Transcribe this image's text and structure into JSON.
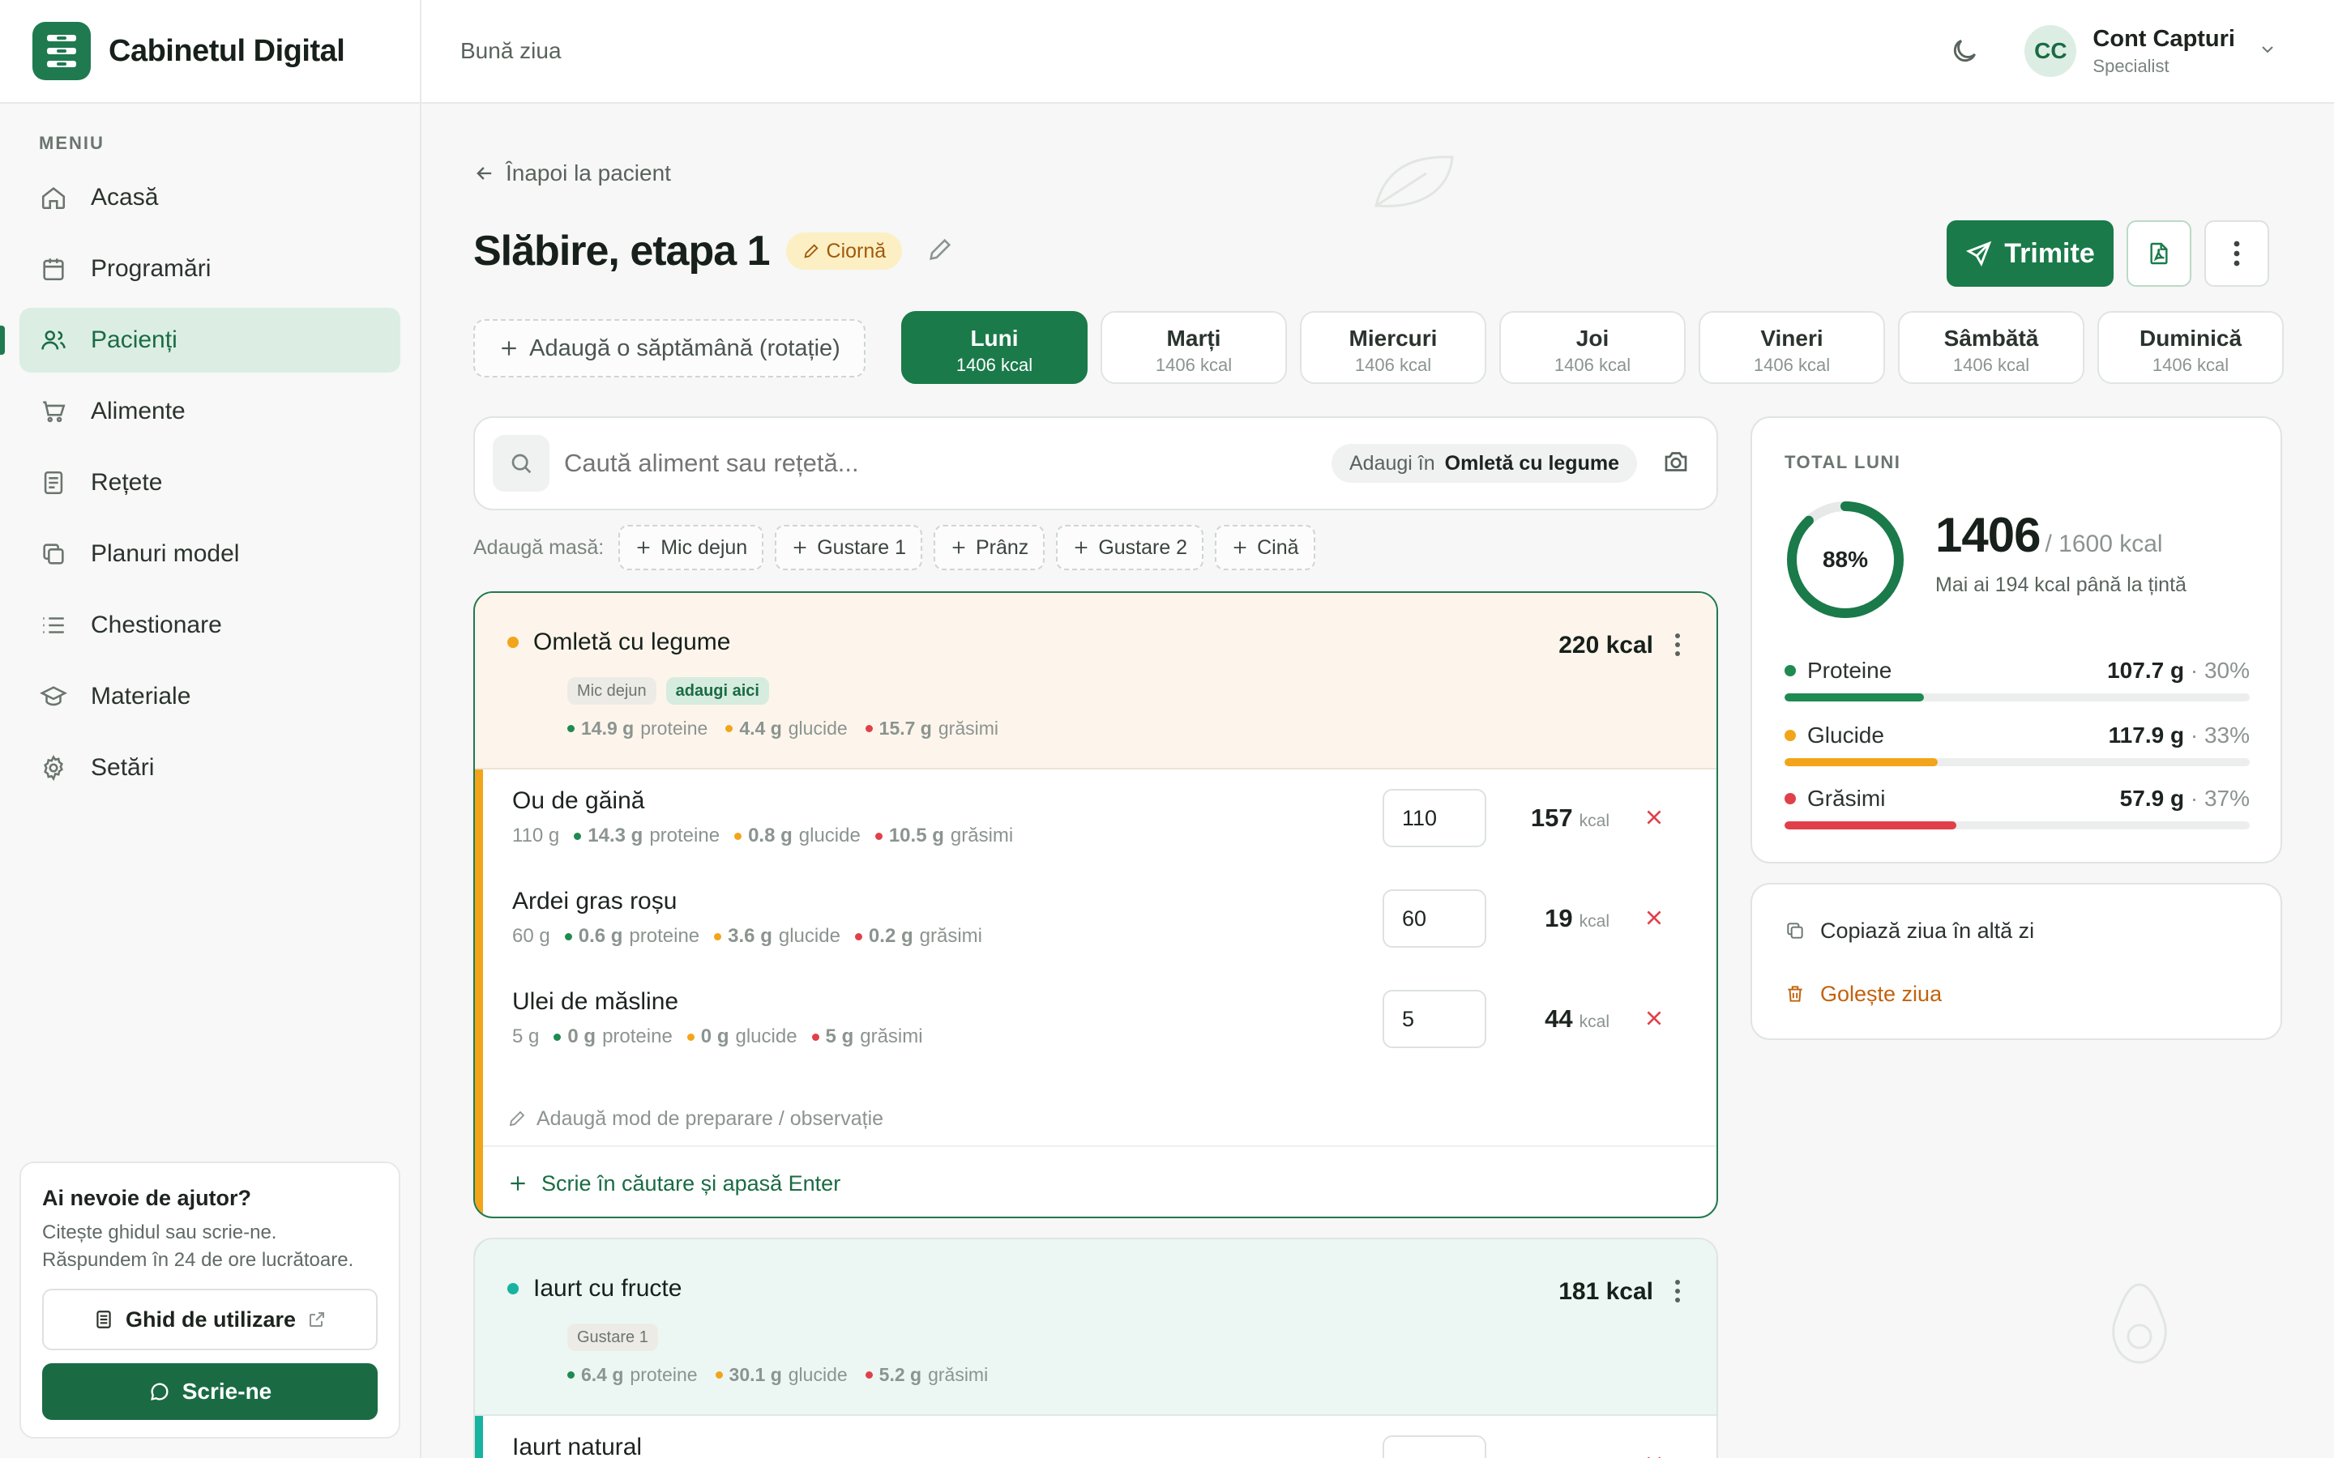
{
  "brand": {
    "name": "Cabinetul Digital"
  },
  "sidebar": {
    "menu_caption": "MENIU",
    "items": [
      {
        "label": "Acasă",
        "icon": "home-icon"
      },
      {
        "label": "Programări",
        "icon": "calendar-icon"
      },
      {
        "label": "Pacienți",
        "icon": "users-icon",
        "active": true
      },
      {
        "label": "Alimente",
        "icon": "cart-icon"
      },
      {
        "label": "Rețete",
        "icon": "recipe-icon"
      },
      {
        "label": "Planuri model",
        "icon": "copy-icon"
      },
      {
        "label": "Chestionare",
        "icon": "list-icon"
      },
      {
        "label": "Materiale",
        "icon": "graduation-icon"
      },
      {
        "label": "Setări",
        "icon": "gear-icon"
      }
    ],
    "help": {
      "title": "Ai nevoie de ajutor?",
      "text": "Citește ghidul sau scrie-ne. Răspundem în 24 de ore lucrătoare.",
      "guide_label": "Ghid de utilizare",
      "write_label": "Scrie-ne"
    }
  },
  "header": {
    "greeting": "Bună ziua",
    "avatar_initials": "CC",
    "account_name": "Cont Capturi",
    "account_role": "Specialist"
  },
  "page": {
    "back_label": "Înapoi la pacient",
    "title": "Slăbire, etapa 1",
    "status_badge": "Ciornă",
    "send_label": "Trimite",
    "add_week_label": "Adaugă o săptămână (rotație)",
    "days": [
      {
        "name": "Luni",
        "kcal": "1406 kcal",
        "active": true
      },
      {
        "name": "Marți",
        "kcal": "1406 kcal"
      },
      {
        "name": "Miercuri",
        "kcal": "1406 kcal"
      },
      {
        "name": "Joi",
        "kcal": "1406 kcal"
      },
      {
        "name": "Vineri",
        "kcal": "1406 kcal"
      },
      {
        "name": "Sâmbătă",
        "kcal": "1406 kcal"
      },
      {
        "name": "Duminică",
        "kcal": "1406 kcal"
      }
    ]
  },
  "search": {
    "placeholder": "Caută aliment sau rețetă...",
    "add_in_prefix": "Adaugi în",
    "add_in_target": "Omletă cu legume"
  },
  "add_meal": {
    "caption": "Adaugă masă:",
    "options": [
      "Mic dejun",
      "Gustare 1",
      "Prânz",
      "Gustare 2",
      "Cină"
    ]
  },
  "meals": [
    {
      "title": "Omletă cu legume",
      "kcal": "220 kcal",
      "tags": [
        "Mic dejun",
        "adaugi aici"
      ],
      "macros": {
        "protein": "14.9 g",
        "carbs": "4.4 g",
        "fat": "15.7 g"
      },
      "foods": [
        {
          "name": "Ou de găină",
          "grams": "110 g",
          "protein": "14.3 g",
          "carbs": "0.8 g",
          "fat": "10.5 g",
          "qty": "110",
          "kcal": "157"
        },
        {
          "name": "Ardei gras roșu",
          "grams": "60 g",
          "protein": "0.6 g",
          "carbs": "3.6 g",
          "fat": "0.2 g",
          "qty": "60",
          "kcal": "19"
        },
        {
          "name": "Ulei de măsline",
          "grams": "5 g",
          "protein": "0 g",
          "carbs": "0 g",
          "fat": "5 g",
          "qty": "5",
          "kcal": "44"
        }
      ],
      "note_label": "Adaugă mod de preparare / observație",
      "enter_label": "Scrie în căutare și apasă Enter"
    },
    {
      "title": "Iaurt cu fructe",
      "kcal": "181 kcal",
      "tags": [
        "Gustare 1"
      ],
      "macros": {
        "protein": "6.4 g",
        "carbs": "30.1 g",
        "fat": "5.2 g"
      },
      "foods": [
        {
          "name": "Iaurt natural"
        }
      ]
    }
  ],
  "labels": {
    "protein": "proteine",
    "carbs": "glucide",
    "fat": "grăsimi",
    "kcal_unit": "kcal"
  },
  "totals": {
    "caption": "TOTAL LUNI",
    "percent": 0.88,
    "percent_label": "88%",
    "value": "1406",
    "target": "/ 1600 kcal",
    "remaining": "Mai ai 194 kcal până la țintă",
    "macros": [
      {
        "name": "Proteine",
        "value": "107.7 g",
        "pct": "· 30%",
        "fill": 0.3,
        "color": "#1f8a52"
      },
      {
        "name": "Glucide",
        "value": "117.9 g",
        "pct": "· 33%",
        "fill": 0.33,
        "color": "#f2a51a"
      },
      {
        "name": "Grăsimi",
        "value": "57.9 g",
        "pct": "· 37%",
        "fill": 0.37,
        "color": "#e0404a"
      }
    ]
  },
  "day_actions": {
    "copy_label": "Copiază ziua în altă zi",
    "clear_label": "Golește ziua"
  },
  "colors": {
    "accent": "#1a7a4a",
    "protein": "#1f8a52",
    "carbs": "#f2a51a",
    "fat": "#e0404a",
    "snack": "#17b3a0"
  }
}
